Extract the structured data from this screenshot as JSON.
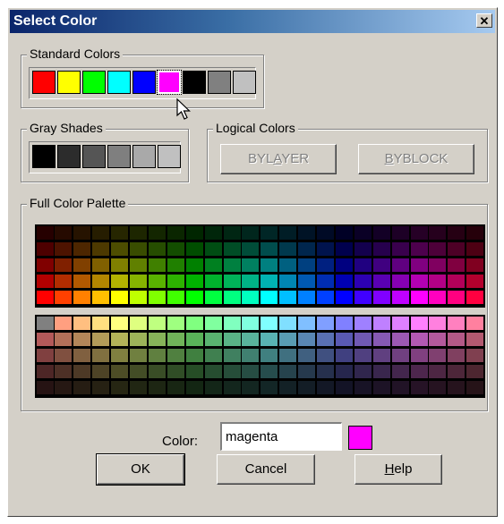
{
  "window": {
    "title": "Select Color",
    "close_glyph": "✕"
  },
  "standard": {
    "legend": "Standard Colors",
    "swatches": [
      "#ff0000",
      "#ffff00",
      "#00ff00",
      "#00ffff",
      "#0000ff",
      "#ff00ff",
      "#000000",
      "#808080",
      "#c0c0c0"
    ],
    "selected_index": 5
  },
  "gray": {
    "legend": "Gray Shades",
    "swatches": [
      "#000000",
      "#2c2c2c",
      "#555555",
      "#7f7f7f",
      "#a9a9a9",
      "#c0c0c0"
    ]
  },
  "logical": {
    "legend": "Logical Colors",
    "bylayer_label": "BYLAYER",
    "byblock_label": "BYBLOCK"
  },
  "full_palette": {
    "legend": "Full Color Palette"
  },
  "color_field": {
    "label": "Color:",
    "value": "magenta"
  },
  "preview_color": "#ff00ff",
  "buttons": {
    "ok": "OK",
    "cancel": "Cancel",
    "help": "Help"
  },
  "icons": {
    "cursor": "arrow-cursor-icon"
  }
}
